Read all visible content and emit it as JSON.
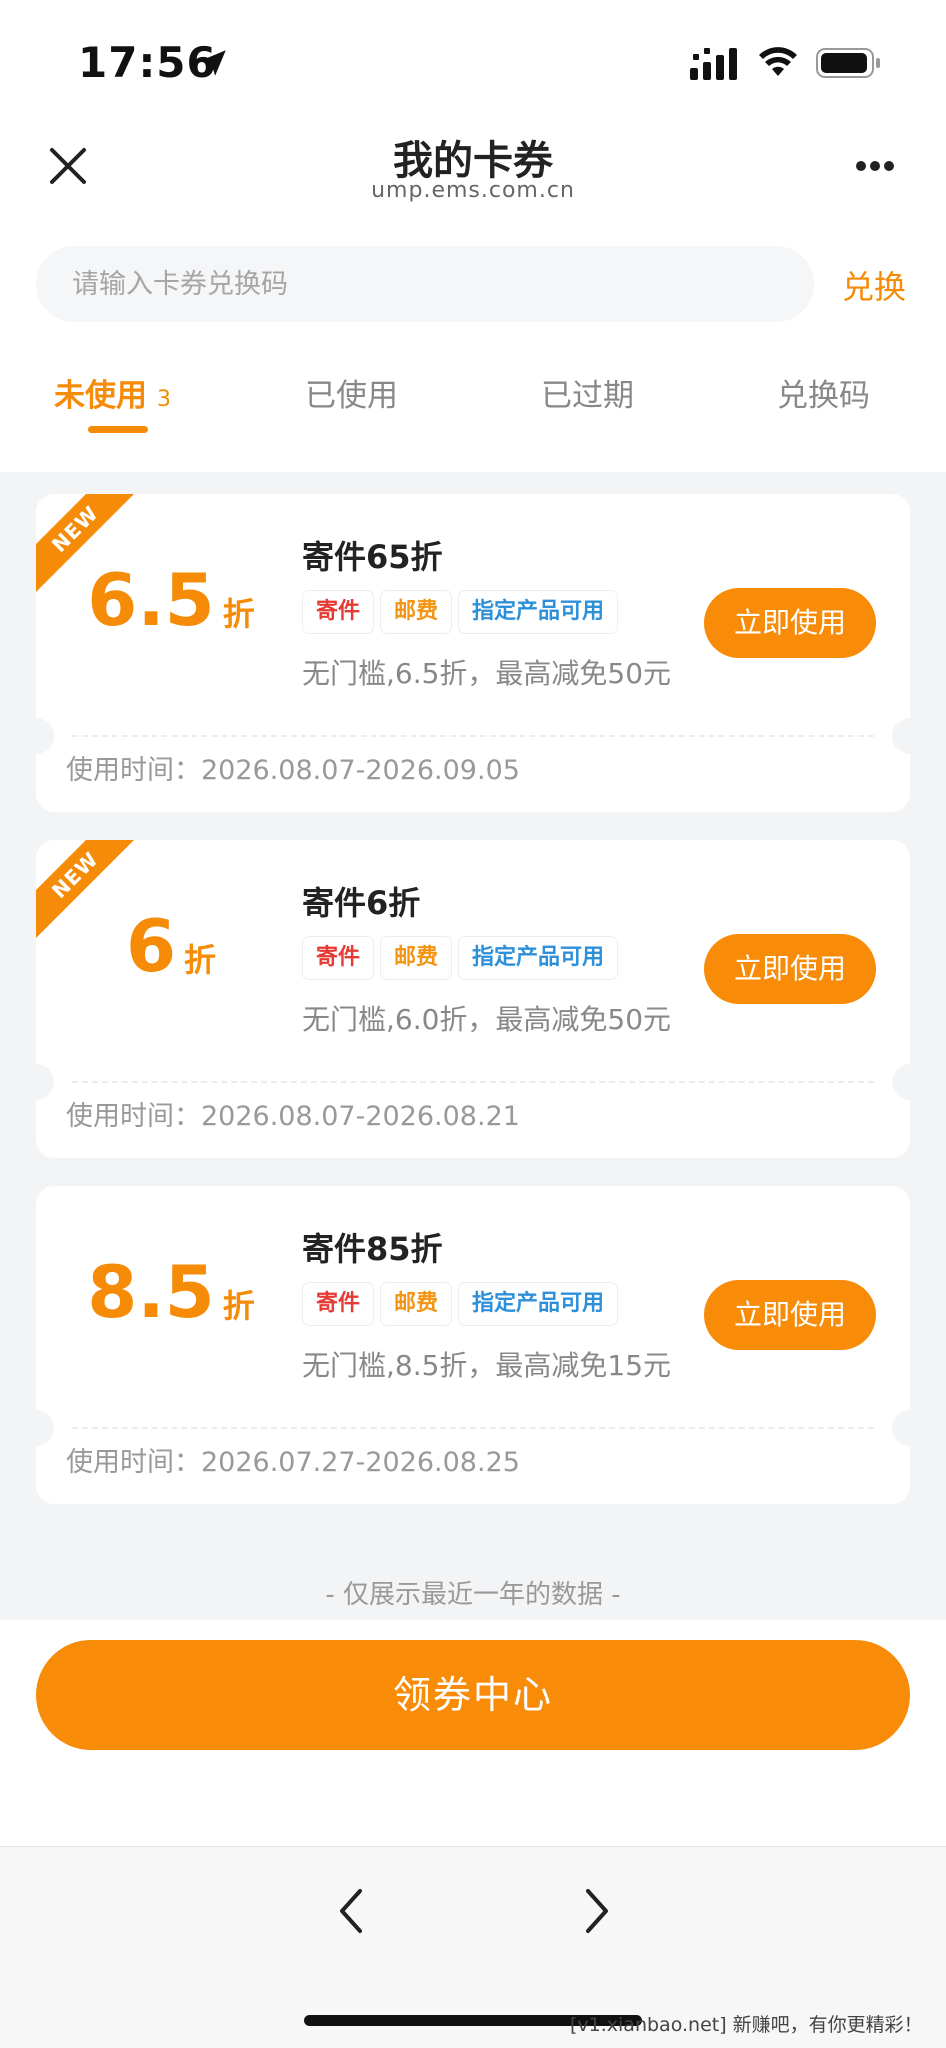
{
  "status_bar": {
    "time": "17:56"
  },
  "nav": {
    "title": "我的卡券",
    "domain": "ump.ems.com.cn"
  },
  "search": {
    "placeholder": "请输入卡券兑换码",
    "value": "",
    "redeem_label": "兑换"
  },
  "tabs": [
    {
      "label": "未使用",
      "count": "3",
      "active": true
    },
    {
      "label": "已使用"
    },
    {
      "label": "已过期"
    },
    {
      "label": "兑换码"
    }
  ],
  "coupons": [
    {
      "is_new": true,
      "new_label": "NEW",
      "discount_value": "6.5",
      "discount_unit": "折",
      "title": "寄件65折",
      "tags": [
        "寄件",
        "邮费",
        "指定产品可用"
      ],
      "description": "无门槛,6.5折，最高减免50元",
      "button_label": "立即使用",
      "validity": "使用时间：2026.08.07-2026.09.05"
    },
    {
      "is_new": true,
      "new_label": "NEW",
      "discount_value": "6",
      "discount_unit": "折",
      "title": "寄件6折",
      "tags": [
        "寄件",
        "邮费",
        "指定产品可用"
      ],
      "description": "无门槛,6.0折，最高减免50元",
      "button_label": "立即使用",
      "validity": "使用时间：2026.08.07-2026.08.21"
    },
    {
      "is_new": false,
      "discount_value": "8.5",
      "discount_unit": "折",
      "title": "寄件85折",
      "tags": [
        "寄件",
        "邮费",
        "指定产品可用"
      ],
      "description": "无门槛,8.5折，最高减免15元",
      "button_label": "立即使用",
      "validity": "使用时间：2026.07.27-2026.08.25"
    }
  ],
  "footer_note": "- 仅展示最近一年的数据 -",
  "bottom": {
    "coupon_center_label": "领券中心"
  },
  "watermark": "[v1.xianbao.net] 新赚吧，有你更精彩！",
  "colors": {
    "accent": "#f58b06",
    "button": "#f88c08",
    "tag_red": "#e63b34",
    "tag_orange": "#f39413",
    "tag_blue": "#2e90d8"
  }
}
